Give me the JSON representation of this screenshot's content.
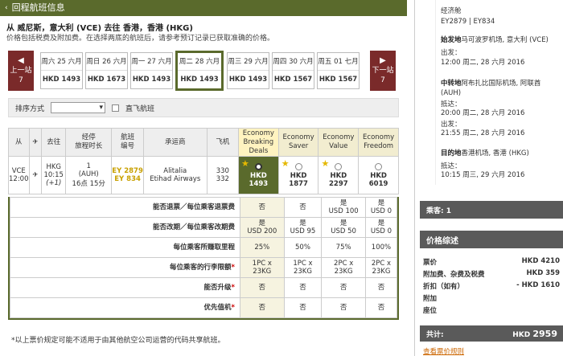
{
  "header": {
    "title": "回程航班信息",
    "chevron": "‹"
  },
  "route": "从 威尼斯，意大利 (VCE) 去往 香港，香港 (HKG)",
  "subtitle": "价格包括税费及附加费。在选择两底的航班后，请参考预订记录已获取准确的价格。",
  "nav": {
    "prev_label": "上一站",
    "prev_num": "7",
    "prev_arrow": "◀",
    "next_label": "下一站",
    "next_num": "7",
    "next_arrow": "▶"
  },
  "days": [
    {
      "date": "周六 25 六月",
      "price": "HKD 1493"
    },
    {
      "date": "周日 26 六月",
      "price": "HKD 1673"
    },
    {
      "date": "周一 27 六月",
      "price": "HKD 1493"
    },
    {
      "date": "周二 28 六月",
      "price": "HKD 1493"
    },
    {
      "date": "周三 29 六月",
      "price": "HKD 1493"
    },
    {
      "date": "周四 30 六月",
      "price": "HKD 1567"
    },
    {
      "date": "周五 01 七月",
      "price": "HKD 1567"
    }
  ],
  "sort": {
    "label": "排序方式",
    "nonstop": "直飞航班"
  },
  "table": {
    "h_from": "从",
    "h_to": "去往",
    "h_stops": "经停\n旅程时长",
    "h_flight": "航班\n编号",
    "h_carrier": "承运商",
    "h_aircraft": "飞机",
    "fares": [
      "Economy Breaking Deals",
      "Economy Saver",
      "Economy Value",
      "Economy Freedom"
    ],
    "row": {
      "from": "VCE",
      "dep": "12:00",
      "to": "HKG",
      "arr": "10:15",
      "plus": "(+1)",
      "stops": "1",
      "via": "(AUH)",
      "dur": "16点 15分",
      "flight1": "EY 2879",
      "flight2": "EY 834",
      "carrier1": "Alitalia",
      "carrier2": "Etihad Airways",
      "ac1": "330",
      "ac2": "332",
      "prices": [
        "HKD\n1493",
        "HKD\n1877",
        "HKD\n2297",
        "HKD\n6019"
      ]
    }
  },
  "details": [
    {
      "label": "能否退票／每位乘客退票费",
      "vals": [
        "否",
        "否",
        "是\nUSD 100",
        "是\nUSD 0"
      ],
      "star": false
    },
    {
      "label": "能否改期／每位乘客改期费",
      "vals": [
        "是\nUSD 200",
        "是\nUSD 95",
        "是\nUSD 50",
        "是\nUSD 0"
      ],
      "star": false
    },
    {
      "label": "每位乘客所赚取里程",
      "vals": [
        "25%",
        "50%",
        "75%",
        "100%"
      ],
      "star": false
    },
    {
      "label": "每位乘客的行李限额",
      "vals": [
        "1PC x\n23KG",
        "1PC x\n23KG",
        "2PC x\n23KG",
        "2PC x\n23KG"
      ],
      "star": true
    },
    {
      "label": "能否升级",
      "vals": [
        "否",
        "否",
        "否",
        "否"
      ],
      "star": true
    },
    {
      "label": "优先值机",
      "vals": [
        "否",
        "否",
        "否",
        "否"
      ],
      "star": true
    }
  ],
  "note": "*以上票价规定可能不适用于由其他航空公司运营的代码共享航班。",
  "right": {
    "econ": "经济舱",
    "flights": "EY2879 | EY834",
    "dep_label": "始发地",
    "dep_place": "马可波罗机场, 意大利 (VCE)",
    "out1": "出发：",
    "out1_time": "12:00 周二, 28 六月 2016",
    "mid_label": "中转地",
    "mid_place": "阿布扎比国际机场, 阿联酋 (AUH)",
    "arr1": "抵达：",
    "arr1_time": "20:00 周二, 28 六月 2016",
    "out2": "出发：",
    "out2_time": "21:55 周二, 28 六月 2016",
    "dst_label": "目的地",
    "dst_place": "香港机场, 香港 (HKG)",
    "arr2": "抵达：",
    "arr2_time": "10:15 周三, 29 六月 2016",
    "pax": "乘客: 1",
    "summary": "价格综述",
    "fare_label": "票价",
    "fare_val": "HKD 4210",
    "tax_label": "附加费、杂费及税费",
    "tax_val": "HKD 359",
    "disc_label": "折扣（如有）",
    "disc_val": "- HKD 1610",
    "extra": "附加",
    "seat": "座位",
    "total_label": "共计:",
    "total_cur": "HKD",
    "total_val": "2959",
    "rules": "查看票价规则"
  }
}
